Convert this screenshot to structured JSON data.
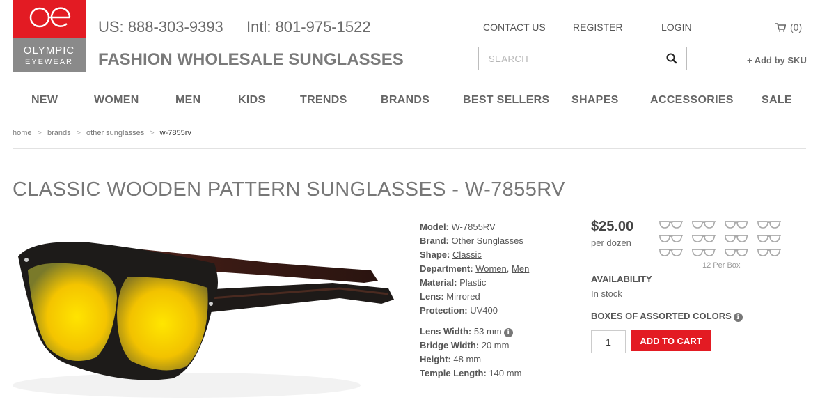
{
  "header": {
    "logo": {
      "name": "OLYMPIC",
      "sub": "EYEWEAR"
    },
    "phone_us": "US: 888-303-9393",
    "phone_intl": "Intl: 801-975-1522",
    "tagline": "FASHION WHOLESALE SUNGLASSES",
    "links": {
      "contact": "CONTACT US",
      "register": "REGISTER",
      "login": "LOGIN"
    },
    "cart_count": "(0)",
    "search_placeholder": "SEARCH",
    "add_by_sku": "+ Add by SKU"
  },
  "nav": [
    "NEW",
    "WOMEN",
    "MEN",
    "KIDS",
    "TRENDS",
    "BRANDS",
    "BEST SELLERS",
    "SHAPES",
    "ACCESSORIES",
    "SALE"
  ],
  "breadcrumb": [
    "home",
    "brands",
    "other sunglasses",
    "w-7855rv"
  ],
  "product": {
    "title": "CLASSIC WOODEN PATTERN SUNGLASSES - W-7855RV",
    "specs": {
      "model_label": "Model:",
      "model": "W-7855RV",
      "brand_label": "Brand:",
      "brand": "Other Sunglasses",
      "shape_label": "Shape:",
      "shape": "Classic",
      "department_label": "Department:",
      "dept_1": "Women",
      "dept_sep": ",",
      "dept_2": "Men",
      "material_label": "Material:",
      "material": "Plastic",
      "lens_label": "Lens:",
      "lens": "Mirrored",
      "protection_label": "Protection:",
      "protection": "UV400",
      "lens_width_label": "Lens Width:",
      "lens_width": "53 mm",
      "bridge_width_label": "Bridge Width:",
      "bridge_width": "20 mm",
      "height_label": "Height:",
      "height": "48 mm",
      "temple_length_label": "Temple Length:",
      "temple_length": "140 mm"
    },
    "price": "$25.00",
    "price_unit": "per dozen",
    "per_box": "12 Per Box",
    "availability_label": "AVAILABILITY",
    "availability": "In stock",
    "boxes_label": "BOXES OF ASSORTED COLORS",
    "quantity": "1",
    "add_to_cart": "ADD TO CART"
  },
  "colors": {
    "brand_red": "#e31b23",
    "logo_gray": "#8a8a8a",
    "text_gray": "#777777"
  }
}
